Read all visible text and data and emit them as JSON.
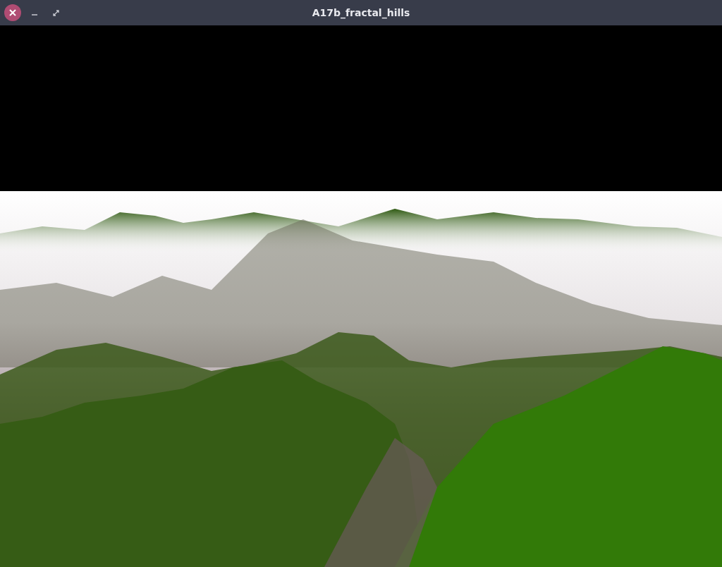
{
  "window": {
    "title": "A17b_fractal_hills"
  }
}
